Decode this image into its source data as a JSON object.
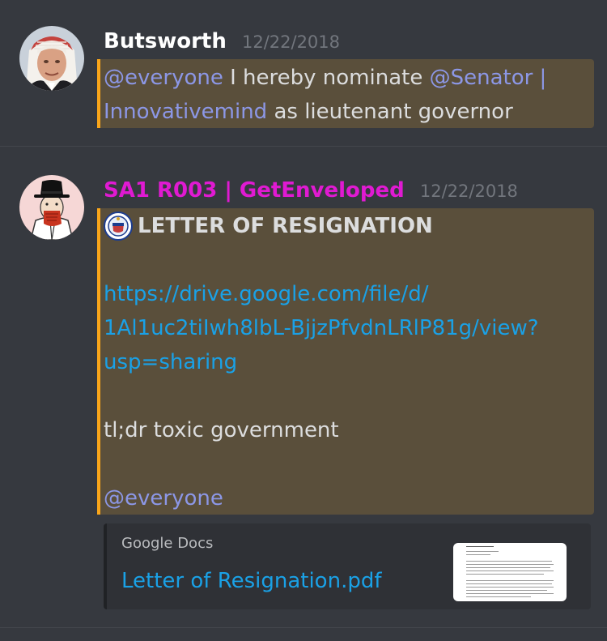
{
  "messages": [
    {
      "author": "Butsworth",
      "author_color": "#ffffff",
      "timestamp": "12/22/2018",
      "avatar_icon": "man-in-red-checkered-headdress-avatar",
      "mention_everyone": "@everyone",
      "text_1": " I hereby nominate ",
      "mention_user_line1": "@Senator |",
      "mention_user_line2": "Innovativemind",
      "text_2": " as lieutenant governor"
    },
    {
      "author": "SA1 R003 | GetEnveloped",
      "author_color": "#e01ad2",
      "timestamp": "12/22/2018",
      "avatar_icon": "cartoon-man-in-black-hat-avatar",
      "emoji_icon": "seal-emoji-icon",
      "title": "LETTER OF RESIGNATION",
      "link_line1": "https://drive.google.com/file/d/",
      "link_line2": "1Al1uc2tiIwh8lbL-BjjzPfvdnLRlP81g/view?",
      "link_line3": "usp=sharing",
      "tldr": "tl;dr toxic government",
      "mention_everyone": "@everyone",
      "embed": {
        "provider": "Google Docs",
        "title": "Letter of Resignation.pdf",
        "thumbnail_icon": "document-page-thumbnail"
      }
    }
  ],
  "colors": {
    "background": "#36393f",
    "mention_highlight": "#5a4f3b",
    "mention_bar": "#faa61a",
    "link": "#1aa1e6",
    "mention": "#8c97e6"
  }
}
